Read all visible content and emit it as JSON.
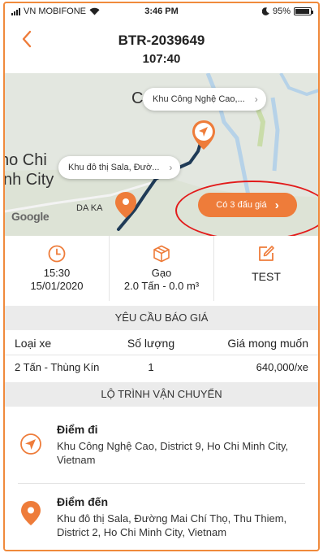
{
  "status_bar": {
    "carrier": "VN MOBIFONE",
    "time": "3:46 PM",
    "battery": "95%",
    "battery_level": 0.95
  },
  "header": {
    "title": "BTR-2039649",
    "subtitle": "107:40"
  },
  "map": {
    "labels": {
      "city_line1": "ho Chi",
      "city_line2": "nh City",
      "district": "DA KA",
      "partial": "C"
    },
    "destination_bubble": "Khu Công Nghệ Cao,...",
    "origin_bubble": "Khu đô thị Sala, Đườ...",
    "google": "Google",
    "bid_button": "Có 3 đấu giá",
    "colors": {
      "route": "#1f3b57",
      "accent": "#ee7c3a",
      "highlight": "#e21b1b"
    }
  },
  "info": {
    "datetime": {
      "time": "15:30",
      "date": "15/01/2020",
      "icon": "clock-icon"
    },
    "cargo": {
      "name": "Gạo",
      "detail": "2.0 Tấn - 0.0 m³",
      "icon": "box-icon"
    },
    "note": {
      "text": "TEST",
      "icon": "edit-icon"
    }
  },
  "quote_section": {
    "title": "YÊU CẦU BÁO GIÁ",
    "headers": [
      "Loại xe",
      "Số lượng",
      "Giá mong muốn"
    ],
    "rows": [
      {
        "vehicle": "2 Tấn - Thùng Kín",
        "quantity": "1",
        "price": "640,000/xe"
      }
    ]
  },
  "route_section": {
    "title": "LỘ TRÌNH VẬN CHUYỂN",
    "pickup": {
      "label": "Điểm đi",
      "address": "Khu Công Nghệ Cao, District 9, Ho Chi Minh City, Vietnam",
      "icon": "navigation-arrow-icon"
    },
    "dropoff": {
      "label": "Điểm đến",
      "address": "Khu đô thị Sala, Đường Mai Chí Thọ, Thu Thiem, District 2, Ho Chi Minh City, Vietnam",
      "icon": "location-pin-icon"
    }
  }
}
